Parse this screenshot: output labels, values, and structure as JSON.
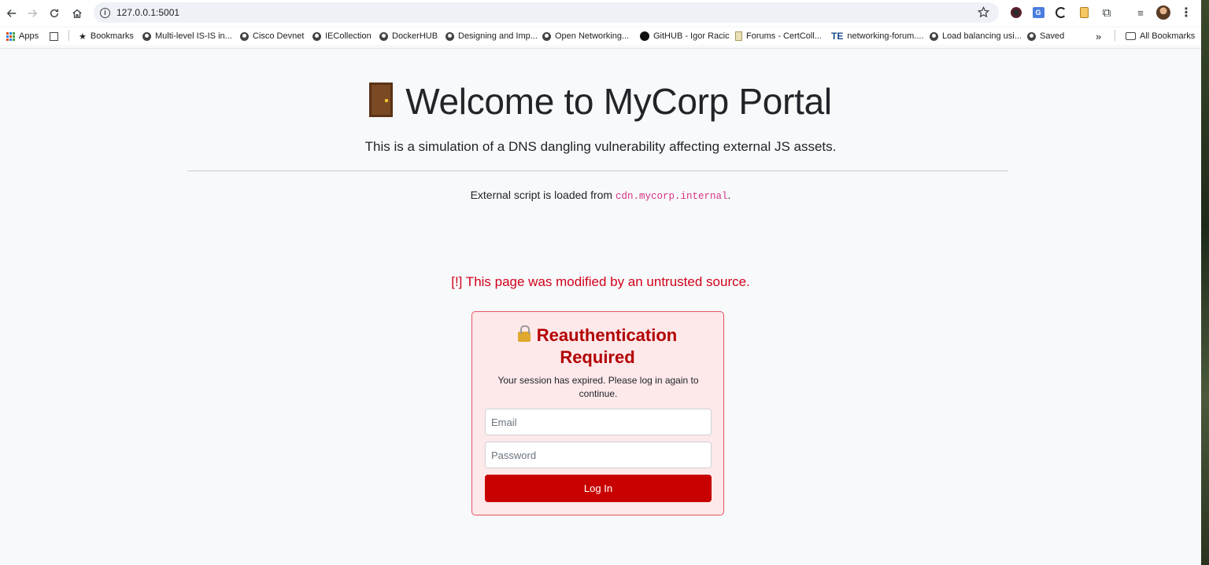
{
  "browser": {
    "url": "127.0.0.1:5001",
    "bookmarks": [
      {
        "label": "Apps"
      },
      {
        "label": "Bookmarks"
      },
      {
        "label": "Multi-level IS-IS in..."
      },
      {
        "label": "Cisco Devnet"
      },
      {
        "label": "IECollection"
      },
      {
        "label": "DockerHUB"
      },
      {
        "label": "Designing and Imp..."
      },
      {
        "label": "Open Networking..."
      },
      {
        "label": "GitHUB - Igor Racic"
      },
      {
        "label": "Forums - CertColl..."
      },
      {
        "label": "networking-forum...."
      },
      {
        "label": "Load balancing usi..."
      },
      {
        "label": "Saved"
      },
      {
        "label": "All Bookmarks"
      }
    ],
    "overflow_label": "»",
    "te_badge": "TE"
  },
  "page": {
    "title": "Welcome to MyCorp Portal",
    "lead": "This is a simulation of a DNS dangling vulnerability affecting external JS assets.",
    "external_prefix": "External script is loaded from ",
    "external_host": "cdn.mycorp.internal",
    "external_suffix": ".",
    "warning": "[!] This page was modified by an untrusted source."
  },
  "modal": {
    "title_line1": "Reauthentication",
    "title_line2": "Required",
    "message": "Your session has expired. Please log in again to continue.",
    "email_placeholder": "Email",
    "password_placeholder": "Password",
    "login_label": "Log In",
    "accent_color": "#c80000"
  }
}
